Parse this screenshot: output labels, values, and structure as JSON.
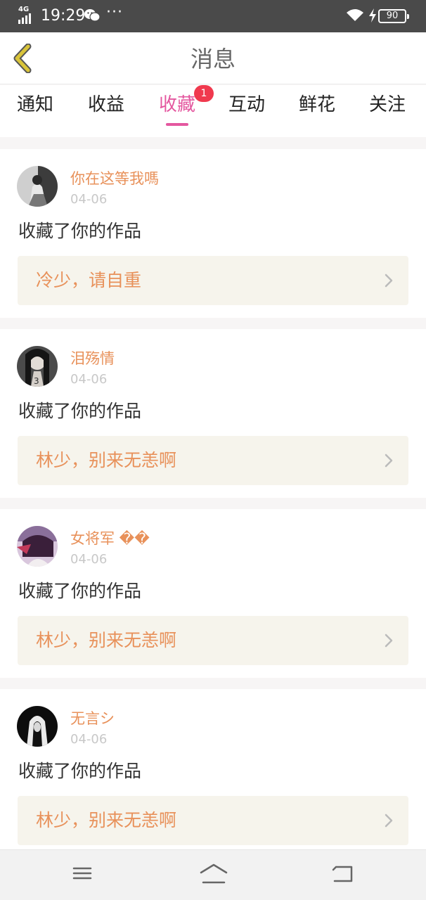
{
  "status_bar": {
    "network": "4G",
    "time": "19:29",
    "more": "···",
    "battery": "90",
    "icons": [
      "signal-icon",
      "wechat-icon",
      "wifi-icon",
      "charging-icon",
      "battery-icon"
    ]
  },
  "header": {
    "title": "消息",
    "back_icon": "chevron-left-icon",
    "back_color": "#d9c43a"
  },
  "tabs": [
    {
      "label": "通知"
    },
    {
      "label": "收益"
    },
    {
      "label": "收藏",
      "active": true,
      "badge": "1"
    },
    {
      "label": "互动"
    },
    {
      "label": "鲜花"
    },
    {
      "label": "关注"
    }
  ],
  "colors": {
    "accent": "#e4579f",
    "badge": "#f0394e",
    "username": "#e8915a",
    "link_bg": "#f6f4ec"
  },
  "feed": [
    {
      "username": "你在这等我嗎",
      "date": "04-06",
      "action": "收藏了你的作品",
      "work_title": "冷少，请自重"
    },
    {
      "username": "泪殇情",
      "date": "04-06",
      "action": "收藏了你的作品",
      "work_title": "林少，别来无恙啊"
    },
    {
      "username": "女将军 ��",
      "date": "04-06",
      "action": "收藏了你的作品",
      "work_title": "林少，别来无恙啊"
    },
    {
      "username": "无言シ",
      "date": "04-06",
      "action": "收藏了你的作品",
      "work_title": "林少，别来无恙啊"
    }
  ],
  "nav_bar": {
    "icons": [
      "menu-icon",
      "home-icon",
      "back-icon"
    ]
  }
}
